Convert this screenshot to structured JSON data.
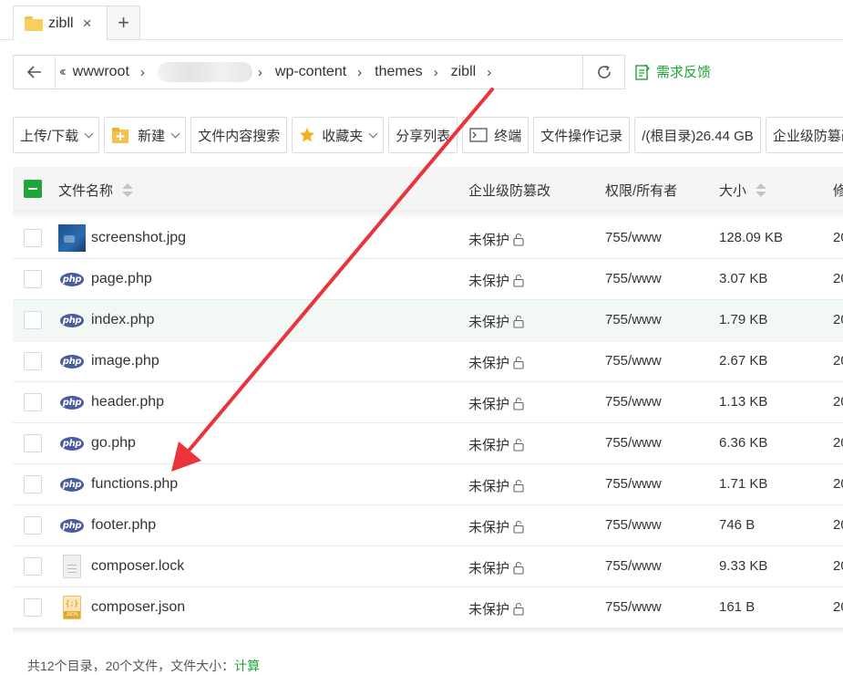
{
  "tab": {
    "label": "zibll",
    "close_glyph": "×",
    "add_glyph": "+",
    "icon": "folder-icon"
  },
  "address": {
    "crumbs": [
      "wwwroot",
      "wp-content",
      "themes",
      "zibll"
    ],
    "feedback_label": "需求反馈"
  },
  "toolbar": {
    "upload": "上传/下载",
    "new": "新建",
    "search_content": "文件内容搜索",
    "favorites": "收藏夹",
    "share_list": "分享列表",
    "terminal": "终端",
    "operation_log": "文件操作记录",
    "disk": "/(根目录)26.44 GB",
    "enterprise": "企业级防篡改"
  },
  "table": {
    "headers": {
      "name": "文件名称",
      "protect": "企业级防篡改",
      "perm": "权限/所有者",
      "size": "大小",
      "modified": "修"
    },
    "rows": [
      {
        "name": "screenshot.jpg",
        "type": "image",
        "protect": "未保护",
        "perm": "755/www",
        "size": "128.09 KB",
        "mod": "20"
      },
      {
        "name": "page.php",
        "type": "php",
        "protect": "未保护",
        "perm": "755/www",
        "size": "3.07 KB",
        "mod": "20"
      },
      {
        "name": "index.php",
        "type": "php",
        "protect": "未保护",
        "perm": "755/www",
        "size": "1.79 KB",
        "mod": "20"
      },
      {
        "name": "image.php",
        "type": "php",
        "protect": "未保护",
        "perm": "755/www",
        "size": "2.67 KB",
        "mod": "20"
      },
      {
        "name": "header.php",
        "type": "php",
        "protect": "未保护",
        "perm": "755/www",
        "size": "1.13 KB",
        "mod": "20"
      },
      {
        "name": "go.php",
        "type": "php",
        "protect": "未保护",
        "perm": "755/www",
        "size": "6.36 KB",
        "mod": "20"
      },
      {
        "name": "functions.php",
        "type": "php",
        "protect": "未保护",
        "perm": "755/www",
        "size": "1.71 KB",
        "mod": "20"
      },
      {
        "name": "footer.php",
        "type": "php",
        "protect": "未保护",
        "perm": "755/www",
        "size": "746 B",
        "mod": "20"
      },
      {
        "name": "composer.lock",
        "type": "text",
        "protect": "未保护",
        "perm": "755/www",
        "size": "9.33 KB",
        "mod": "20"
      },
      {
        "name": "composer.json",
        "type": "json",
        "protect": "未保护",
        "perm": "755/www",
        "size": "161 B",
        "mod": "20"
      }
    ]
  },
  "footer": {
    "summary": "共12个目录，20个文件，文件大小：",
    "calc_link": "计算"
  },
  "colors": {
    "accent": "#20a53a",
    "arrow": "#e8343a",
    "php_badge": "#4a5b9e"
  }
}
